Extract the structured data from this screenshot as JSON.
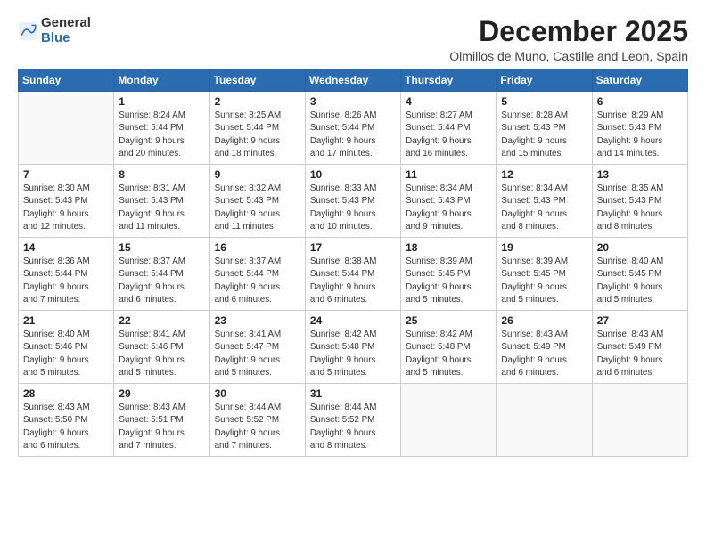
{
  "logo": {
    "general": "General",
    "blue": "Blue"
  },
  "title": "December 2025",
  "location": "Olmillos de Muno, Castille and Leon, Spain",
  "days_of_week": [
    "Sunday",
    "Monday",
    "Tuesday",
    "Wednesday",
    "Thursday",
    "Friday",
    "Saturday"
  ],
  "weeks": [
    [
      {
        "day": "",
        "info": ""
      },
      {
        "day": "1",
        "info": "Sunrise: 8:24 AM\nSunset: 5:44 PM\nDaylight: 9 hours\nand 20 minutes."
      },
      {
        "day": "2",
        "info": "Sunrise: 8:25 AM\nSunset: 5:44 PM\nDaylight: 9 hours\nand 18 minutes."
      },
      {
        "day": "3",
        "info": "Sunrise: 8:26 AM\nSunset: 5:44 PM\nDaylight: 9 hours\nand 17 minutes."
      },
      {
        "day": "4",
        "info": "Sunrise: 8:27 AM\nSunset: 5:44 PM\nDaylight: 9 hours\nand 16 minutes."
      },
      {
        "day": "5",
        "info": "Sunrise: 8:28 AM\nSunset: 5:43 PM\nDaylight: 9 hours\nand 15 minutes."
      },
      {
        "day": "6",
        "info": "Sunrise: 8:29 AM\nSunset: 5:43 PM\nDaylight: 9 hours\nand 14 minutes."
      }
    ],
    [
      {
        "day": "7",
        "info": "Sunrise: 8:30 AM\nSunset: 5:43 PM\nDaylight: 9 hours\nand 12 minutes."
      },
      {
        "day": "8",
        "info": "Sunrise: 8:31 AM\nSunset: 5:43 PM\nDaylight: 9 hours\nand 11 minutes."
      },
      {
        "day": "9",
        "info": "Sunrise: 8:32 AM\nSunset: 5:43 PM\nDaylight: 9 hours\nand 11 minutes."
      },
      {
        "day": "10",
        "info": "Sunrise: 8:33 AM\nSunset: 5:43 PM\nDaylight: 9 hours\nand 10 minutes."
      },
      {
        "day": "11",
        "info": "Sunrise: 8:34 AM\nSunset: 5:43 PM\nDaylight: 9 hours\nand 9 minutes."
      },
      {
        "day": "12",
        "info": "Sunrise: 8:34 AM\nSunset: 5:43 PM\nDaylight: 9 hours\nand 8 minutes."
      },
      {
        "day": "13",
        "info": "Sunrise: 8:35 AM\nSunset: 5:43 PM\nDaylight: 9 hours\nand 8 minutes."
      }
    ],
    [
      {
        "day": "14",
        "info": "Sunrise: 8:36 AM\nSunset: 5:44 PM\nDaylight: 9 hours\nand 7 minutes."
      },
      {
        "day": "15",
        "info": "Sunrise: 8:37 AM\nSunset: 5:44 PM\nDaylight: 9 hours\nand 6 minutes."
      },
      {
        "day": "16",
        "info": "Sunrise: 8:37 AM\nSunset: 5:44 PM\nDaylight: 9 hours\nand 6 minutes."
      },
      {
        "day": "17",
        "info": "Sunrise: 8:38 AM\nSunset: 5:44 PM\nDaylight: 9 hours\nand 6 minutes."
      },
      {
        "day": "18",
        "info": "Sunrise: 8:39 AM\nSunset: 5:45 PM\nDaylight: 9 hours\nand 5 minutes."
      },
      {
        "day": "19",
        "info": "Sunrise: 8:39 AM\nSunset: 5:45 PM\nDaylight: 9 hours\nand 5 minutes."
      },
      {
        "day": "20",
        "info": "Sunrise: 8:40 AM\nSunset: 5:45 PM\nDaylight: 9 hours\nand 5 minutes."
      }
    ],
    [
      {
        "day": "21",
        "info": "Sunrise: 8:40 AM\nSunset: 5:46 PM\nDaylight: 9 hours\nand 5 minutes."
      },
      {
        "day": "22",
        "info": "Sunrise: 8:41 AM\nSunset: 5:46 PM\nDaylight: 9 hours\nand 5 minutes."
      },
      {
        "day": "23",
        "info": "Sunrise: 8:41 AM\nSunset: 5:47 PM\nDaylight: 9 hours\nand 5 minutes."
      },
      {
        "day": "24",
        "info": "Sunrise: 8:42 AM\nSunset: 5:48 PM\nDaylight: 9 hours\nand 5 minutes."
      },
      {
        "day": "25",
        "info": "Sunrise: 8:42 AM\nSunset: 5:48 PM\nDaylight: 9 hours\nand 5 minutes."
      },
      {
        "day": "26",
        "info": "Sunrise: 8:43 AM\nSunset: 5:49 PM\nDaylight: 9 hours\nand 6 minutes."
      },
      {
        "day": "27",
        "info": "Sunrise: 8:43 AM\nSunset: 5:49 PM\nDaylight: 9 hours\nand 6 minutes."
      }
    ],
    [
      {
        "day": "28",
        "info": "Sunrise: 8:43 AM\nSunset: 5:50 PM\nDaylight: 9 hours\nand 6 minutes."
      },
      {
        "day": "29",
        "info": "Sunrise: 8:43 AM\nSunset: 5:51 PM\nDaylight: 9 hours\nand 7 minutes."
      },
      {
        "day": "30",
        "info": "Sunrise: 8:44 AM\nSunset: 5:52 PM\nDaylight: 9 hours\nand 7 minutes."
      },
      {
        "day": "31",
        "info": "Sunrise: 8:44 AM\nSunset: 5:52 PM\nDaylight: 9 hours\nand 8 minutes."
      },
      {
        "day": "",
        "info": ""
      },
      {
        "day": "",
        "info": ""
      },
      {
        "day": "",
        "info": ""
      }
    ]
  ]
}
